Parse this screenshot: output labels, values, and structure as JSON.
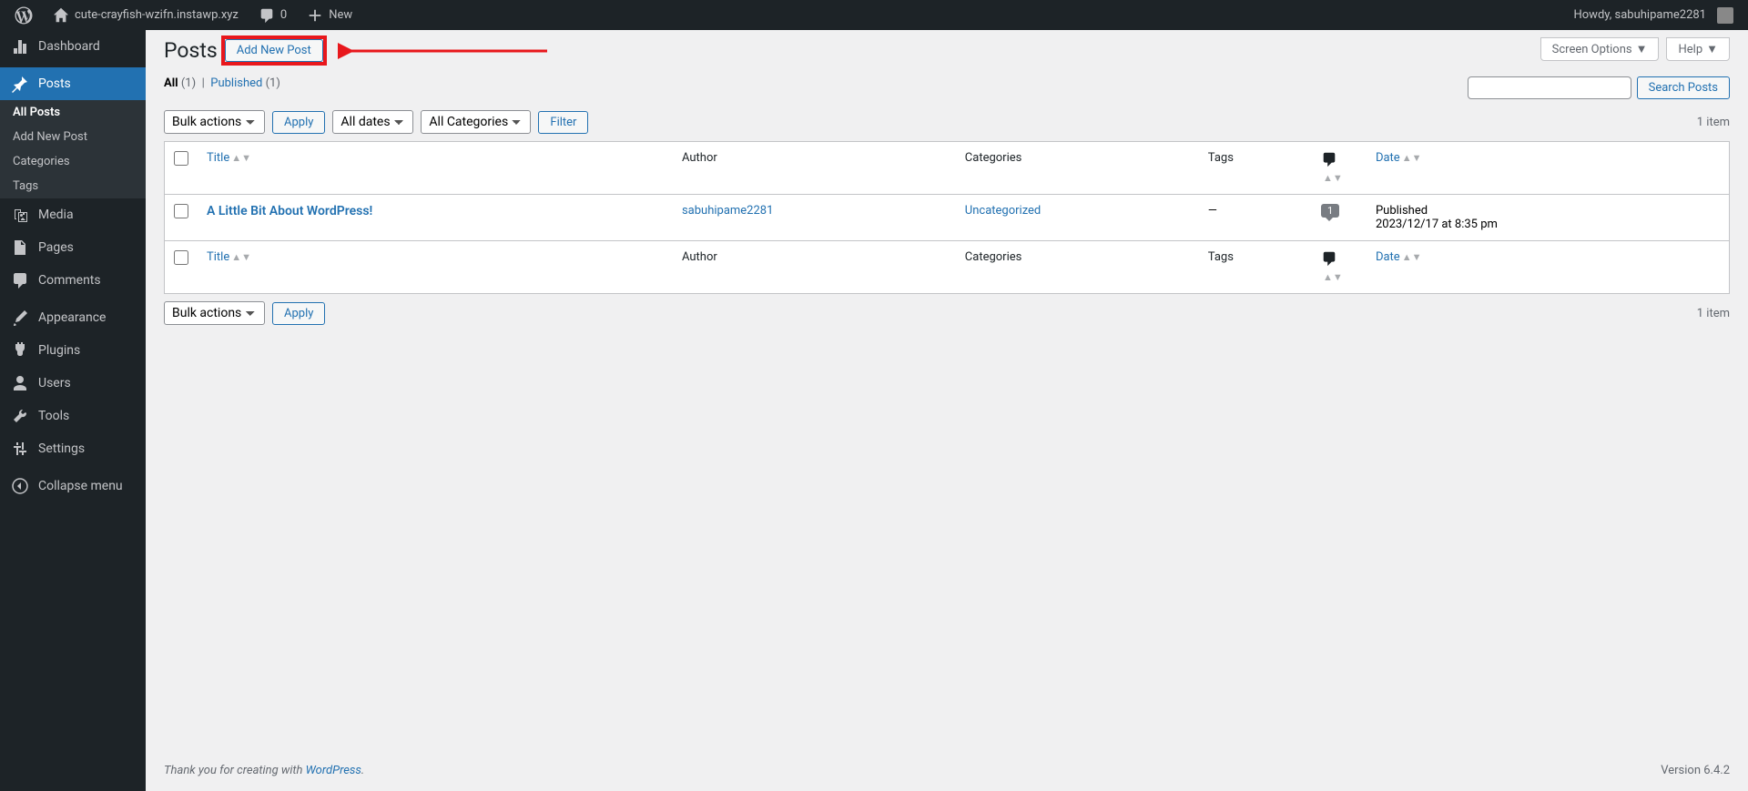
{
  "adminbar": {
    "site_name": "cute-crayfish-wzifn.instawp.xyz",
    "comments_count": "0",
    "new_label": "New",
    "howdy": "Howdy, sabuhipame2281"
  },
  "sidebar": {
    "dashboard": "Dashboard",
    "posts": "Posts",
    "posts_sub": {
      "all": "All Posts",
      "add": "Add New Post",
      "cats": "Categories",
      "tags": "Tags"
    },
    "media": "Media",
    "pages": "Pages",
    "comments": "Comments",
    "appearance": "Appearance",
    "plugins": "Plugins",
    "users": "Users",
    "tools": "Tools",
    "settings": "Settings",
    "collapse": "Collapse menu"
  },
  "screen_meta": {
    "screen_options": "Screen Options",
    "help": "Help"
  },
  "page": {
    "title": "Posts",
    "add_new": "Add New Post",
    "subsub": {
      "all": "All",
      "all_count": "(1)",
      "sep": "|",
      "published": "Published",
      "published_count": "(1)"
    },
    "search_btn": "Search Posts",
    "bulk_actions": "Bulk actions",
    "apply": "Apply",
    "all_dates": "All dates",
    "all_categories": "All Categories",
    "filter": "Filter",
    "item_count": "1 item",
    "cols": {
      "title": "Title",
      "author": "Author",
      "categories": "Categories",
      "tags": "Tags",
      "date": "Date"
    },
    "row": {
      "title": "A Little Bit About WordPress!",
      "author": "sabuhipame2281",
      "categories": "Uncategorized",
      "tags": "—",
      "comments": "1",
      "date_status": "Published",
      "date": "2023/12/17 at 8:35 pm"
    }
  },
  "footer": {
    "thank": "Thank you for creating with ",
    "wp": "WordPress",
    "dot": ".",
    "version": "Version 6.4.2"
  }
}
